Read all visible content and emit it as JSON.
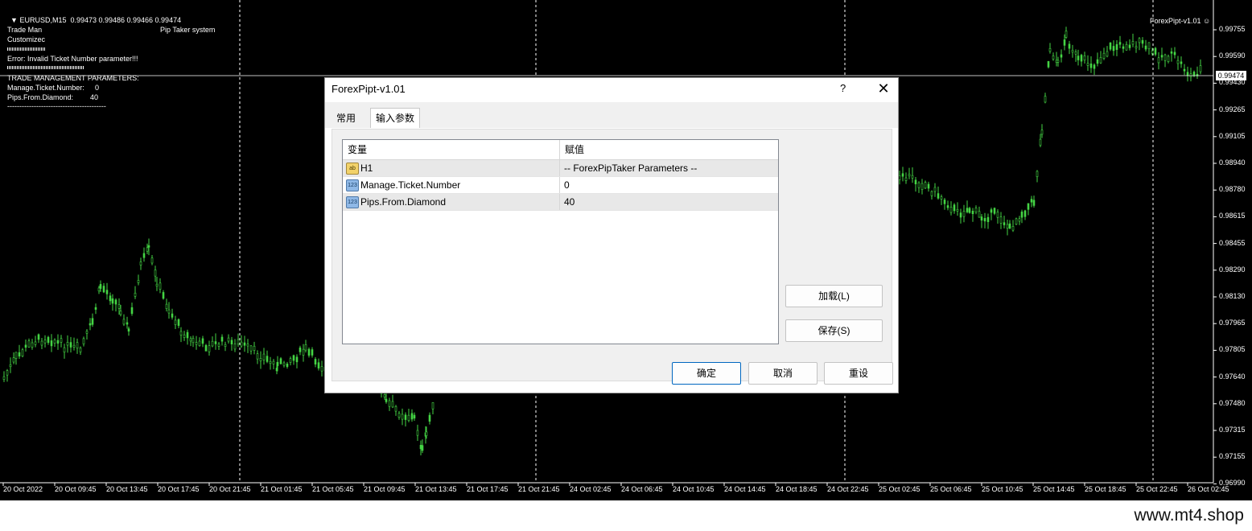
{
  "chart": {
    "symbol_line": "EURUSD,M15  0.99473 0.99486 0.99466 0.99474",
    "indicator_name": "ForexPipt-v1.01",
    "current_price": "0.99474",
    "overlay": {
      "line1": "Trade Man",
      "system_label": "Pip Taker system",
      "line2": "Customizec",
      "error": "Error: Invalid Ticket Number parameter!!!",
      "section": "TRADE MANAGEMENT PARAMETERS:",
      "param1_label": "Manage.Ticket.Number:",
      "param1_value": "0",
      "param2_label": "Pips.From.Diamond:",
      "param2_value": "40",
      "rule": "-----------------------------------------"
    },
    "colors": {
      "candle": "#44d444",
      "background": "#000000",
      "grid": "#ffffff"
    }
  },
  "chart_data": {
    "type": "line",
    "title": "",
    "yticks": [
      "0.99755",
      "0.99590",
      "0.99430",
      "0.99265",
      "0.99105",
      "0.98940",
      "0.98780",
      "0.98615",
      "0.98455",
      "0.98290",
      "0.98130",
      "0.97965",
      "0.97805",
      "0.97640",
      "0.97480",
      "0.97315",
      "0.97155",
      "0.96990"
    ],
    "xticks": [
      "20 Oct 2022",
      "20 Oct 09:45",
      "20 Oct 13:45",
      "20 Oct 17:45",
      "20 Oct 21:45",
      "21 Oct 01:45",
      "21 Oct 05:45",
      "21 Oct 09:45",
      "21 Oct 13:45",
      "21 Oct 17:45",
      "21 Oct 21:45",
      "24 Oct 02:45",
      "24 Oct 06:45",
      "24 Oct 10:45",
      "24 Oct 14:45",
      "24 Oct 18:45",
      "24 Oct 22:45",
      "25 Oct 02:45",
      "25 Oct 06:45",
      "25 Oct 10:45",
      "25 Oct 14:45",
      "25 Oct 18:45",
      "25 Oct 22:45",
      "26 Oct 02:45"
    ],
    "ylim": [
      0.9699,
      0.9786
    ],
    "x_index": [
      0,
      40,
      80,
      120,
      160,
      170,
      190,
      225,
      230,
      245,
      262,
      288,
      310,
      330,
      345,
      350,
      370,
      380
    ],
    "close": [
      0.9765,
      0.9778,
      0.9776,
      0.9785,
      0.9784,
      0.9778,
      0.9774,
      0.9771,
      0.9772,
      0.9789,
      0.9791,
      0.9788,
      0.9786,
      0.9787,
      0.9799,
      0.9796,
      0.9795,
      0.9794
    ],
    "grid": true
  },
  "dialog": {
    "title": "ForexPipt-v1.01",
    "help": "?",
    "close": "✕",
    "tabs": [
      "常用",
      "输入参数"
    ],
    "headers": [
      "变量",
      "赋值"
    ],
    "rows": [
      {
        "icon": "ab",
        "name": "H1",
        "value": "-- ForexPipTaker Parameters --"
      },
      {
        "icon": "123",
        "name": "Manage.Ticket.Number",
        "value": "0"
      },
      {
        "icon": "123",
        "name": "Pips.From.Diamond",
        "value": "40"
      }
    ],
    "load_label": "加载(L)",
    "save_label": "保存(S)",
    "ok_label": "确定",
    "cancel_label": "取消",
    "reset_label": "重设"
  },
  "watermark": "www.mt4.shop"
}
